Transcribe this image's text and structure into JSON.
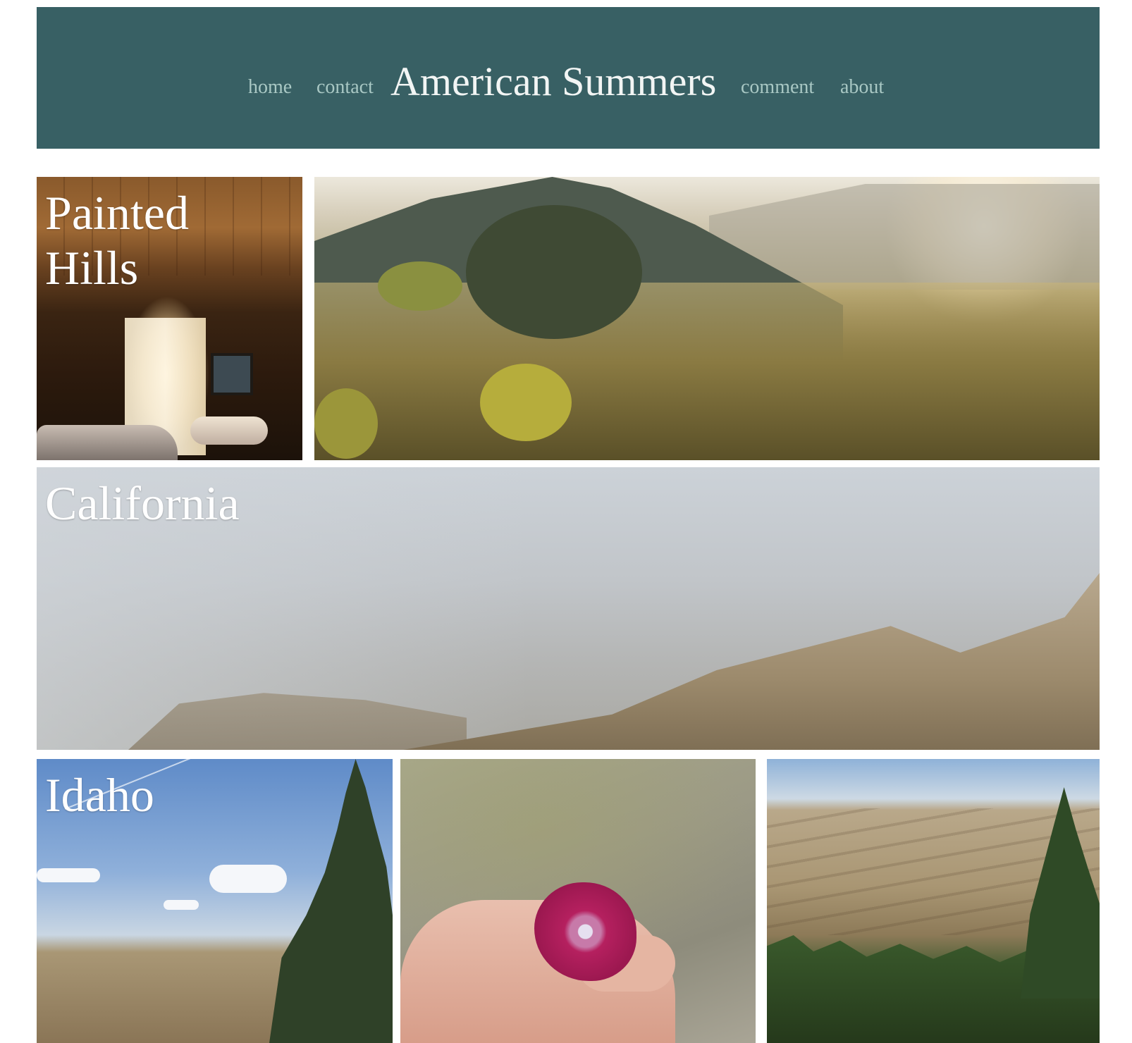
{
  "site": {
    "title": "American Summers",
    "nav": {
      "home": "home",
      "contact": "contact",
      "comment": "comment",
      "about": "about"
    }
  },
  "gallery": {
    "painted_hills_label": "Painted Hills",
    "california_label": "California",
    "idaho_label": "Idaho"
  },
  "colors": {
    "header_bg": "#386064",
    "nav_link": "#a9c8c4",
    "title": "#f2f5f4"
  }
}
